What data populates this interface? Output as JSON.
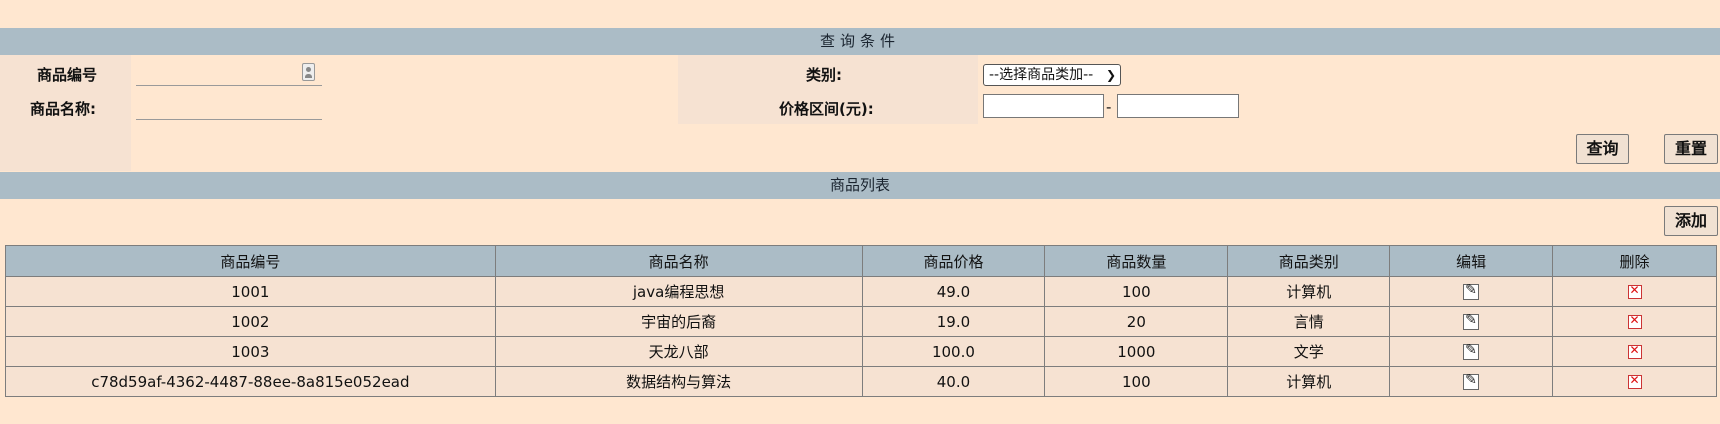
{
  "query": {
    "section_title": "查询条件",
    "product_id_label": "商品编号",
    "product_id_value": "",
    "product_name_label": "商品名称:",
    "product_name_value": "",
    "category_label": "类别:",
    "category_select": "--选择商品类加--",
    "price_label": "价格区间(元):",
    "price_min": "",
    "price_max": "",
    "price_sep": "-",
    "search_button": "查询",
    "reset_button": "重置"
  },
  "list": {
    "section_title": "商品列表",
    "add_button": "添加",
    "columns": [
      "商品编号",
      "商品名称",
      "商品价格",
      "商品数量",
      "商品类别",
      "编辑",
      "删除"
    ],
    "rows": [
      {
        "id": "1001",
        "name": "java编程思想",
        "price": "49.0",
        "qty": "100",
        "category": "计算机"
      },
      {
        "id": "1002",
        "name": "宇宙的后裔",
        "price": "19.0",
        "qty": "20",
        "category": "言情"
      },
      {
        "id": "1003",
        "name": "天龙八部",
        "price": "100.0",
        "qty": "1000",
        "category": "文学"
      },
      {
        "id": "c78d59af-4362-4487-88ee-8a815e052ead",
        "name": "数据结构与算法",
        "price": "40.0",
        "qty": "100",
        "category": "计算机"
      }
    ],
    "edit_icon": "edit-icon",
    "delete_icon": "delete-icon"
  },
  "colors": {
    "background": "#ffe7d0",
    "header_bar": "#abbcc6",
    "panel": "#f6e2d2"
  }
}
